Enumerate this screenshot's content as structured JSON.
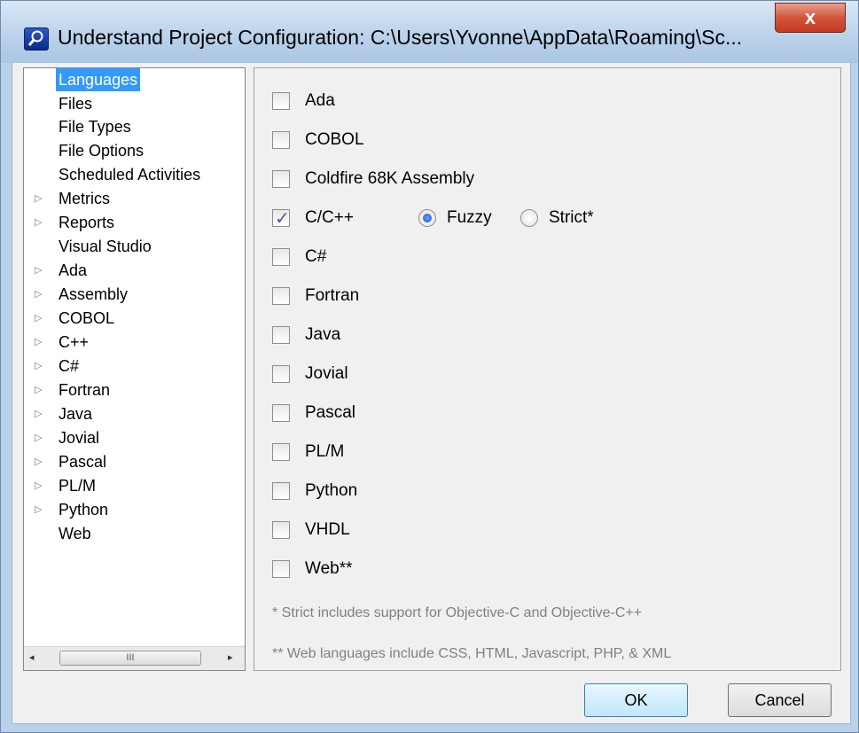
{
  "window": {
    "title": "Understand Project Configuration: C:\\Users\\Yvonne\\AppData\\Roaming\\Sc...",
    "close_label": "x"
  },
  "tree": {
    "items": [
      {
        "label": "Languages",
        "expandable": false,
        "selected": true
      },
      {
        "label": "Files",
        "expandable": false
      },
      {
        "label": "File Types",
        "expandable": false
      },
      {
        "label": "File Options",
        "expandable": false
      },
      {
        "label": "Scheduled Activities",
        "expandable": false
      },
      {
        "label": "Metrics",
        "expandable": true
      },
      {
        "label": "Reports",
        "expandable": true
      },
      {
        "label": "Visual Studio",
        "expandable": false
      },
      {
        "label": "Ada",
        "expandable": true
      },
      {
        "label": "Assembly",
        "expandable": true
      },
      {
        "label": "COBOL",
        "expandable": true
      },
      {
        "label": "C++",
        "expandable": true
      },
      {
        "label": "C#",
        "expandable": true
      },
      {
        "label": "Fortran",
        "expandable": true
      },
      {
        "label": "Java",
        "expandable": true
      },
      {
        "label": "Jovial",
        "expandable": true
      },
      {
        "label": "Pascal",
        "expandable": true
      },
      {
        "label": "PL/M",
        "expandable": true
      },
      {
        "label": "Python",
        "expandable": true
      },
      {
        "label": "Web",
        "expandable": false
      }
    ],
    "scroll_left": "◂",
    "scroll_right": "▸",
    "scroll_thumb": "III"
  },
  "languages": [
    {
      "label": "Ada",
      "checked": false
    },
    {
      "label": "COBOL",
      "checked": false
    },
    {
      "label": "Coldfire 68K Assembly",
      "checked": false
    },
    {
      "label": "C/C++",
      "checked": true
    },
    {
      "label": "C#",
      "checked": false
    },
    {
      "label": "Fortran",
      "checked": false
    },
    {
      "label": "Java",
      "checked": false
    },
    {
      "label": "Jovial",
      "checked": false
    },
    {
      "label": "Pascal",
      "checked": false
    },
    {
      "label": "PL/M",
      "checked": false
    },
    {
      "label": "Python",
      "checked": false
    },
    {
      "label": "VHDL",
      "checked": false
    },
    {
      "label": "Web**",
      "checked": false
    }
  ],
  "cpp_mode": {
    "fuzzy_label": "Fuzzy",
    "strict_label": "Strict*",
    "selected": "Fuzzy"
  },
  "footnotes": {
    "strict": "* Strict includes support for Objective-C and Objective-C++",
    "web": "** Web languages include CSS, HTML, Javascript, PHP, & XML"
  },
  "buttons": {
    "ok": "OK",
    "cancel": "Cancel"
  }
}
